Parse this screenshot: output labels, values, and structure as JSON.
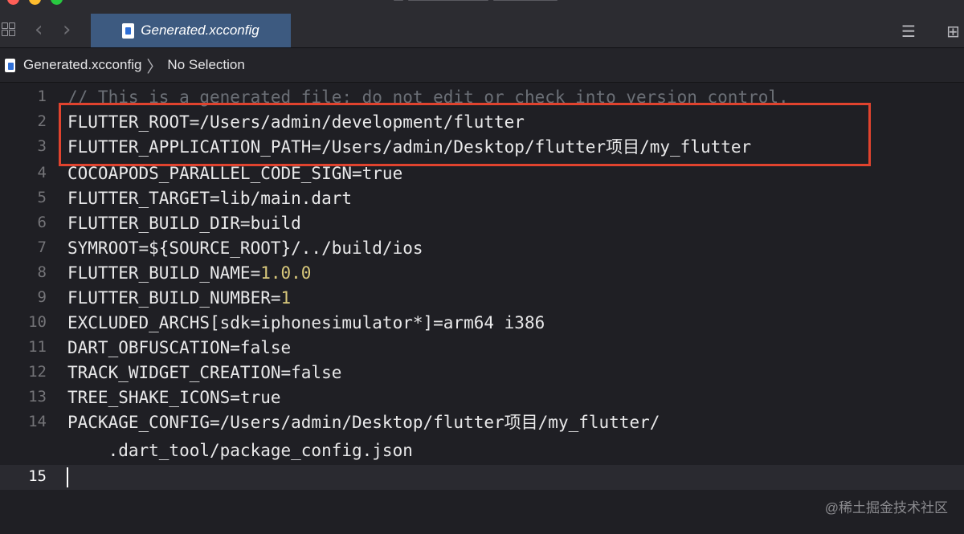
{
  "tabbar": {
    "active_tab": "Generated.xcconfig"
  },
  "breadcrumb": {
    "file": "Generated.xcconfig",
    "selection": "No Selection"
  },
  "editor": {
    "lines": [
      {
        "n": "1",
        "text": "// This is a generated file; do not edit or check into version control."
      },
      {
        "n": "2",
        "text": "FLUTTER_ROOT=/Users/admin/development/flutter"
      },
      {
        "n": "3",
        "text": "FLUTTER_APPLICATION_PATH=/Users/admin/Desktop/flutter项目/my_flutter"
      },
      {
        "n": "4",
        "text": "COCOAPODS_PARALLEL_CODE_SIGN=true"
      },
      {
        "n": "5",
        "text": "FLUTTER_TARGET=lib/main.dart"
      },
      {
        "n": "6",
        "text": "FLUTTER_BUILD_DIR=build"
      },
      {
        "n": "7",
        "text": "SYMROOT=${SOURCE_ROOT}/../build/ios"
      },
      {
        "n": "8",
        "key": "FLUTTER_BUILD_NAME=",
        "value": "1.0.0"
      },
      {
        "n": "9",
        "key": "FLUTTER_BUILD_NUMBER=",
        "value": "1"
      },
      {
        "n": "10",
        "text": "EXCLUDED_ARCHS[sdk=iphonesimulator*]=arm64 i386"
      },
      {
        "n": "11",
        "text": "DART_OBFUSCATION=false"
      },
      {
        "n": "12",
        "text": "TRACK_WIDGET_CREATION=false"
      },
      {
        "n": "13",
        "text": "TREE_SHAKE_ICONS=true"
      },
      {
        "n": "14",
        "text": "PACKAGE_CONFIG=/Users/admin/Desktop/flutter项目/my_flutter/"
      },
      {
        "n": "",
        "text": "    .dart_tool/package_config.json"
      },
      {
        "n": "15",
        "text": ""
      }
    ]
  },
  "watermark": "@稀土掘金技术社区"
}
